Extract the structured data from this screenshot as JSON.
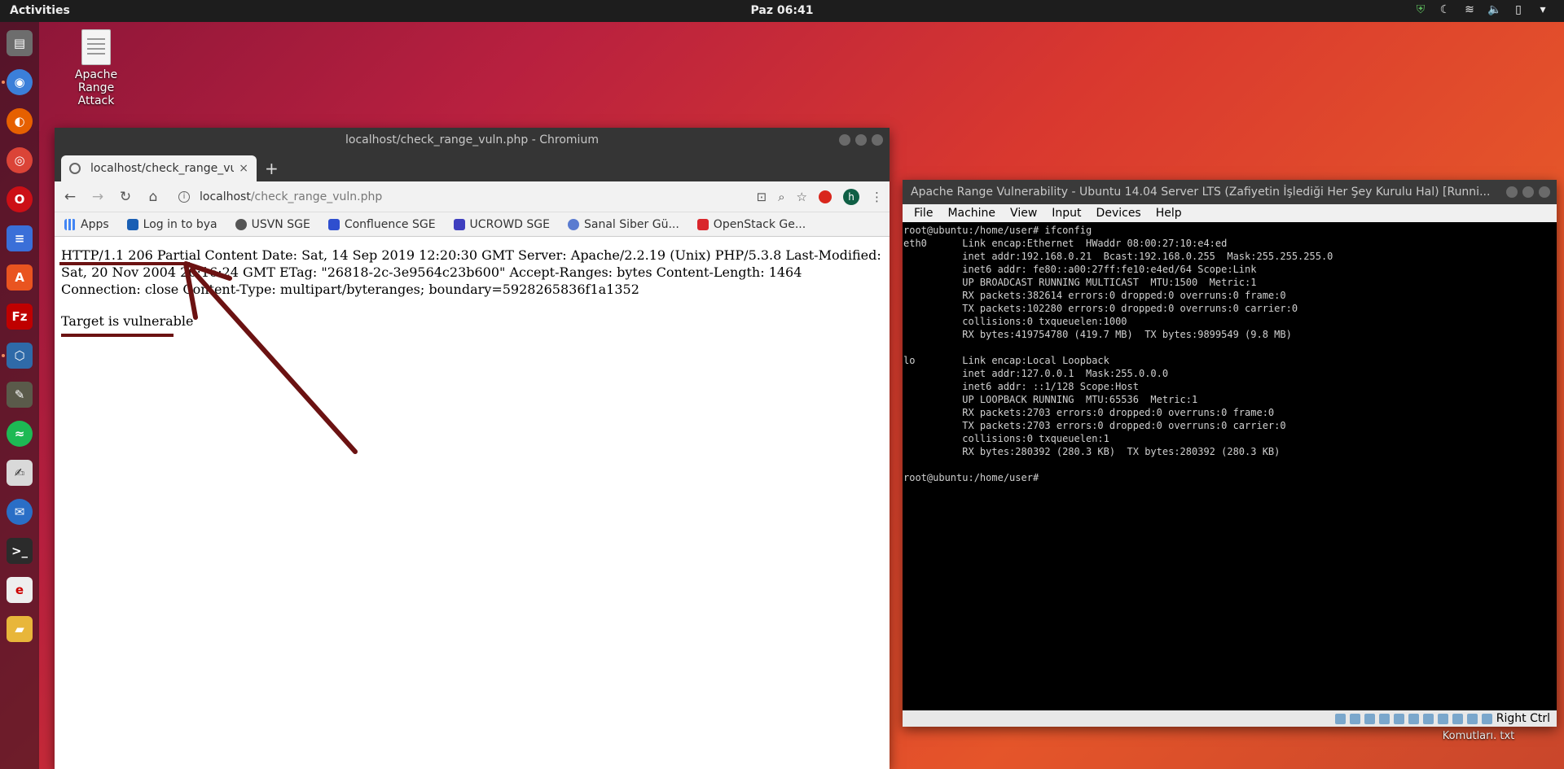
{
  "topbar": {
    "activities": "Activities",
    "clock": "Paz 06:41"
  },
  "desktop": {
    "icon1_label": "Apache Range Attack",
    "icon2_label": "Komutları. txt"
  },
  "chromium": {
    "window_title": "localhost/check_range_vuln.php - Chromium",
    "tab_title": "localhost/check_range_vu",
    "tab_close": "×",
    "new_tab": "+",
    "url_host": "localhost",
    "url_path": "/check_range_vuln.php",
    "avatar_letter": "h",
    "bookmarks": [
      "Apps",
      "Log in to bya",
      "USVN SGE",
      "Confluence SGE",
      "UCROWD SGE",
      "Sanal Siber Gü...",
      "OpenStack Ge..."
    ],
    "response_text": "HTTP/1.1 206 Partial Content Date: Sat, 14 Sep 2019 12:20:30 GMT Server: Apache/2.2.19 (Unix) PHP/5.3.8 Last-Modified: Sat, 20 Nov 2004 20:16:24 GMT ETag: \"26818-2c-3e9564c23b600\" Accept-Ranges: bytes Content-Length: 1464 Connection: close Content-Type: multipart/byteranges; boundary=5928265836f1a1352",
    "result_text": "Target is vulnerable"
  },
  "vbox": {
    "window_title": "Apache Range Vulnerability - Ubuntu 14.04 Server LTS (Zafiyetin İşlediği Her Şey Kurulu Hal) [Runni...",
    "menu": [
      "File",
      "Machine",
      "View",
      "Input",
      "Devices",
      "Help"
    ],
    "terminal_text": "root@ubuntu:/home/user# ifconfig\neth0      Link encap:Ethernet  HWaddr 08:00:27:10:e4:ed\n          inet addr:192.168.0.21  Bcast:192.168.0.255  Mask:255.255.255.0\n          inet6 addr: fe80::a00:27ff:fe10:e4ed/64 Scope:Link\n          UP BROADCAST RUNNING MULTICAST  MTU:1500  Metric:1\n          RX packets:382614 errors:0 dropped:0 overruns:0 frame:0\n          TX packets:102280 errors:0 dropped:0 overruns:0 carrier:0\n          collisions:0 txqueuelen:1000\n          RX bytes:419754780 (419.7 MB)  TX bytes:9899549 (9.8 MB)\n\nlo        Link encap:Local Loopback\n          inet addr:127.0.0.1  Mask:255.0.0.0\n          inet6 addr: ::1/128 Scope:Host\n          UP LOOPBACK RUNNING  MTU:65536  Metric:1\n          RX packets:2703 errors:0 dropped:0 overruns:0 frame:0\n          TX packets:2703 errors:0 dropped:0 overruns:0 carrier:0\n          collisions:0 txqueuelen:1\n          RX bytes:280392 (280.3 KB)  TX bytes:280392 (280.3 KB)\n\nroot@ubuntu:/home/user#",
    "host_key": "Right Ctrl"
  },
  "colors": {
    "annotation": "#6b1212",
    "dock_bg": "#2a1420"
  }
}
